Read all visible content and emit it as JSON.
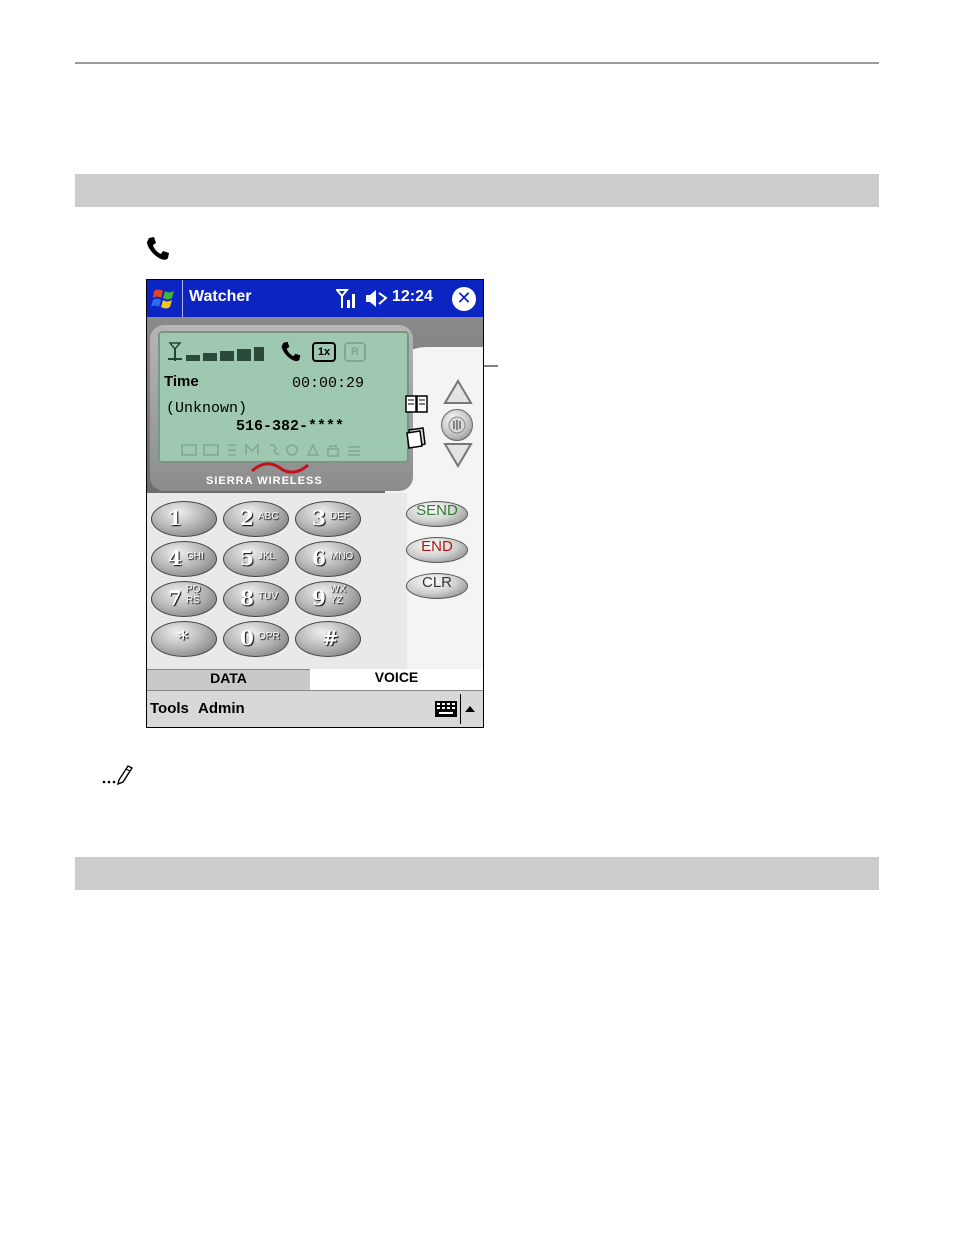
{
  "window": {
    "title": "Watcher",
    "time": "12:24",
    "close_glyph": "✕"
  },
  "lcd": {
    "time_label": "Time",
    "call_timer": "00:00:29",
    "caller_name": "(Unknown)",
    "caller_number": "516-382-****",
    "network_badge": "1x",
    "roam_badge": "R"
  },
  "brand": "SIERRA WIRELESS",
  "keypad": [
    {
      "num": "1",
      "sub": ""
    },
    {
      "num": "2",
      "sub": "ABC"
    },
    {
      "num": "3",
      "sub": "DEF"
    },
    {
      "num": "4",
      "sub": "GHI"
    },
    {
      "num": "5",
      "sub": "JKL"
    },
    {
      "num": "6",
      "sub": "MNO"
    },
    {
      "num": "7",
      "sub": "PQ RS"
    },
    {
      "num": "8",
      "sub": "TUV"
    },
    {
      "num": "9",
      "sub": "WX YZ"
    },
    {
      "num": "*",
      "sub": ""
    },
    {
      "num": "0",
      "sub": "OPR"
    },
    {
      "num": "#",
      "sub": ""
    }
  ],
  "function_keys": {
    "send": "SEND",
    "end": "END",
    "clear": "CLR"
  },
  "tabs": {
    "data": "DATA",
    "voice": "VOICE"
  },
  "menu": {
    "tools": "Tools",
    "admin": "Admin"
  },
  "colors": {
    "titlebar": "#0b24c2",
    "lcd": "#9fc8b0",
    "send_text": "#2e7d2e",
    "end_text": "#b01818"
  },
  "icons": [
    "phone-icon",
    "note-pencil-icon",
    "windows-start-icon",
    "signal-icon",
    "speaker-icon",
    "keyboard-icon"
  ]
}
